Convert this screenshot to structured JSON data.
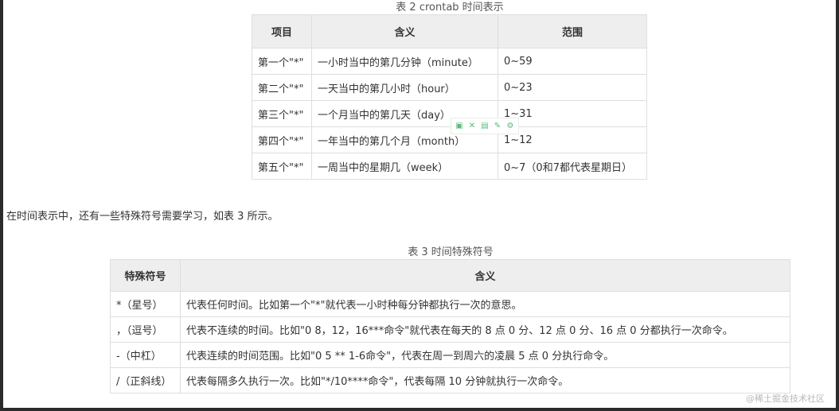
{
  "table2": {
    "caption": "表 2 crontab 时间表示",
    "headers": [
      "项目",
      "含义",
      "范围"
    ],
    "rows": [
      [
        "第一个\"*\"",
        "一小时当中的第几分钟（minute）",
        "0~59"
      ],
      [
        "第二个\"*\"",
        "一天当中的第几小时（hour）",
        "0~23"
      ],
      [
        "第三个\"*\"",
        "一个月当中的第几天（day）",
        "1~31"
      ],
      [
        "第四个\"*\"",
        "一年当中的第几个月（month）",
        "1~12"
      ],
      [
        "第五个\"*\"",
        "一周当中的星期几（week）",
        "0~7（0和7都代表星期日）"
      ]
    ]
  },
  "paragraph": "在时间表示中，还有一些特殊符号需要学习，如表 3 所示。",
  "table3": {
    "caption": "表 3 时间特殊符号",
    "headers": [
      "特殊符号",
      "含义"
    ],
    "rows": [
      [
        "*（星号）",
        "代表任何时间。比如第一个\"*\"就代表一小时种每分钟都执行一次的意思。"
      ],
      [
        "，（逗号）",
        "代表不连续的时间。比如\"0 8，12，16***命令\"就代表在每天的 8 点 0 分、12 点 0 分、16 点 0 分都执行一次命令。"
      ],
      [
        "-（中杠）",
        "代表连续的时间范围。比如\"0 5 ** 1-6命令\"，代表在周一到周六的凌晨 5 点 0 分执行命令。"
      ],
      [
        "/（正斜线）",
        "代表每隔多久执行一次。比如\"*/10****命令\"，代表每隔 10 分钟就执行一次命令。"
      ]
    ]
  },
  "overlay_toolbar": {
    "icons": [
      "image-icon",
      "expand-icon",
      "copy-icon",
      "edit-icon",
      "settings-icon"
    ],
    "glyphs": [
      "▣",
      "✕",
      "▤",
      "✎",
      "⚙"
    ],
    "color": "#5cb87a"
  },
  "watermark": "@稀土掘金技术社区"
}
